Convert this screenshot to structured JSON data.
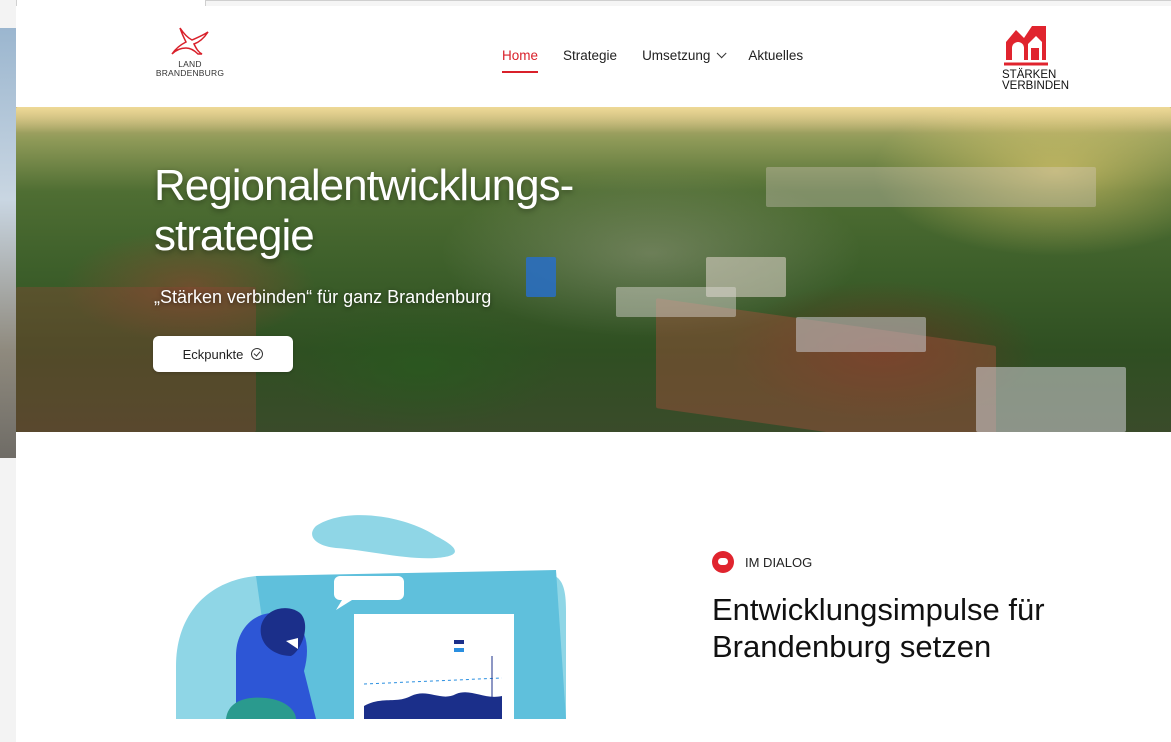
{
  "header": {
    "logo_left": {
      "line1": "LAND",
      "line2": "BRANDENBURG",
      "icon": "eagle-icon",
      "color": "#d9202a"
    },
    "nav": [
      {
        "label": "Home",
        "active": true
      },
      {
        "label": "Strategie",
        "active": false
      },
      {
        "label": "Umsetzung",
        "active": false,
        "has_dropdown": true
      },
      {
        "label": "Aktuelles",
        "active": false
      }
    ],
    "logo_right": {
      "line1": "STÄRKEN",
      "line2": "VERBINDEN",
      "icon": "houses-icon",
      "color": "#e0242e"
    }
  },
  "hero": {
    "title": "Regionalentwicklungs-strategie",
    "subtitle": "„Stärken verbinden“ für ganz Brandenburg",
    "button_label": "Eckpunkte",
    "button_icon": "check-circle-icon"
  },
  "dialog": {
    "tag": "IM DIALOG",
    "tag_icon": "chat-bubble-icon",
    "heading": "Entwicklungsimpulse für Brandenburg setzen"
  },
  "colors": {
    "accent": "#d9202a",
    "illustration_blue": "#62c6e0",
    "illustration_dark": "#1b2f8a"
  }
}
